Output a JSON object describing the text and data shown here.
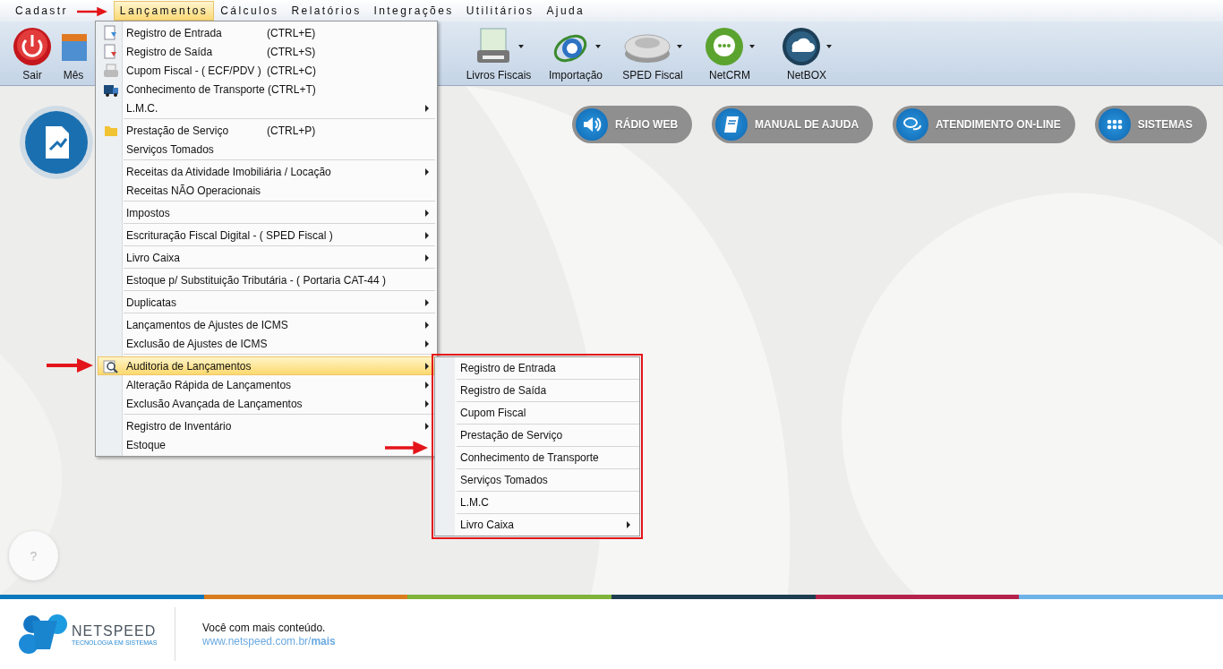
{
  "menubar": [
    {
      "label": "Cadastr",
      "selected": false
    },
    {
      "label": "Lançamentos",
      "selected": true
    },
    {
      "label": "Cálculos",
      "selected": false
    },
    {
      "label": "Relatórios",
      "selected": false
    },
    {
      "label": "Integrações",
      "selected": false
    },
    {
      "label": "Utilitários",
      "selected": false
    },
    {
      "label": "Ajuda",
      "selected": false
    }
  ],
  "toolbar": [
    {
      "label": "Sair",
      "dropdown": false
    },
    {
      "label": "Mês",
      "dropdown": false
    },
    {
      "label": "Livros Fiscais",
      "dropdown": true
    },
    {
      "label": "Importação",
      "dropdown": true
    },
    {
      "label": "SPED Fiscal",
      "dropdown": true
    },
    {
      "label": "NetCRM",
      "dropdown": true
    },
    {
      "label": "NetBOX",
      "dropdown": true
    }
  ],
  "quick_links": [
    "RÁDIO WEB",
    "MANUAL DE AJUDA",
    "ATENDIMENTO ON-LINE",
    "SISTEMAS"
  ],
  "help_button": "?",
  "menu": [
    [
      {
        "label": "Registro de Entrada",
        "shortcut": "(CTRL+E)",
        "submenu": false,
        "selected": false
      },
      {
        "label": "Registro de Saída",
        "shortcut": "(CTRL+S)",
        "submenu": false,
        "selected": false
      },
      {
        "label": "Cupom Fiscal - ( ECF/PDV )",
        "shortcut": "(CTRL+C)",
        "submenu": false,
        "selected": false
      },
      {
        "label": "Conhecimento de Transporte (CTRL+T)",
        "submenu": false,
        "selected": false
      },
      {
        "label": "L.M.C.",
        "submenu": true,
        "selected": false
      }
    ],
    [
      {
        "label": "Prestação de Serviço",
        "shortcut": "(CTRL+P)",
        "submenu": false,
        "selected": false
      },
      {
        "label": "Serviços Tomados",
        "submenu": false,
        "selected": false
      }
    ],
    [
      {
        "label": "Receitas da Atividade Imobiliária / Locação",
        "submenu": true,
        "selected": false
      },
      {
        "label": "Receitas NÃO Operacionais",
        "submenu": false,
        "selected": false
      }
    ],
    [
      {
        "label": "Impostos",
        "submenu": true,
        "selected": false
      }
    ],
    [
      {
        "label": "Escrituração Fiscal Digital - ( SPED Fiscal )",
        "submenu": true,
        "selected": false
      }
    ],
    [
      {
        "label": "Livro Caixa",
        "submenu": true,
        "selected": false
      }
    ],
    [
      {
        "label": "Estoque p/ Substituição Tributária - ( Portaria CAT-44 )",
        "submenu": false,
        "selected": false
      }
    ],
    [
      {
        "label": "Duplicatas",
        "submenu": true,
        "selected": false
      }
    ],
    [
      {
        "label": "Lançamentos de Ajustes de ICMS",
        "submenu": true,
        "selected": false
      },
      {
        "label": "Exclusão de Ajustes de ICMS",
        "submenu": true,
        "selected": false
      }
    ],
    [
      {
        "label": "Auditoria de Lançamentos",
        "submenu": true,
        "selected": true
      },
      {
        "label": "Alteração Rápida de Lançamentos",
        "submenu": true,
        "selected": false
      },
      {
        "label": "Exclusão Avançada de Lançamentos",
        "submenu": true,
        "selected": false
      }
    ],
    [
      {
        "label": "Registro de Inventário",
        "submenu": true,
        "selected": false
      },
      {
        "label": "Estoque",
        "submenu": false,
        "selected": false
      }
    ]
  ],
  "submenu": [
    {
      "label": "Registro de Entrada",
      "submenu": false
    },
    {
      "label": "Registro de Saída",
      "submenu": false
    },
    {
      "label": "Cupom Fiscal",
      "submenu": false
    },
    {
      "label": "Prestação de Serviço",
      "submenu": false
    },
    {
      "label": "Conhecimento de Transporte",
      "submenu": false
    },
    {
      "label": "Serviços Tomados",
      "submenu": false
    },
    {
      "label": "L.M.C",
      "submenu": false
    },
    {
      "label": "Livro Caixa",
      "submenu": true
    }
  ],
  "footer": {
    "brand": "NETSPEED",
    "tagline": "TECNOLOGIA EM SISTEMAS",
    "slogan": "Você com mais conteúdo.",
    "link": "www.netspeed.com.br/**mais**"
  }
}
